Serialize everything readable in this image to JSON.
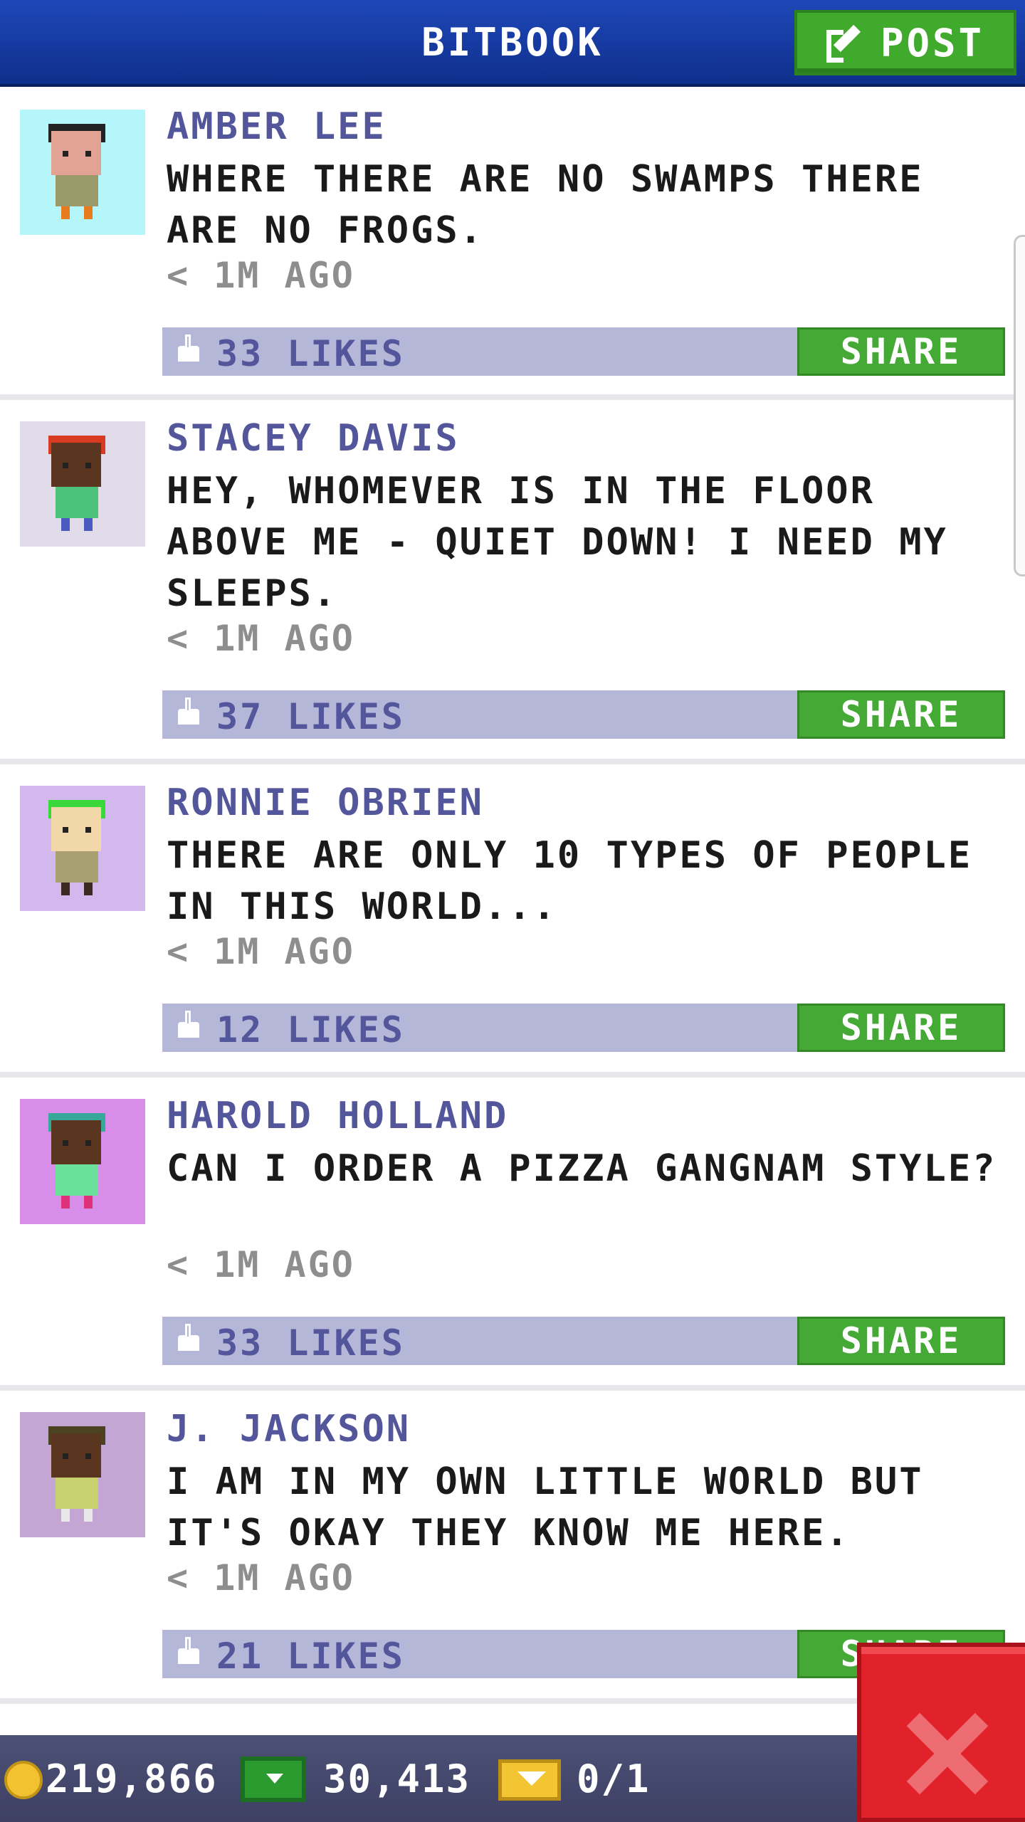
{
  "header": {
    "title": "BITBOOK",
    "post_label": "POST"
  },
  "posts": [
    {
      "name": "AMBER LEE",
      "message": "WHERE THERE ARE NO SWAMPS THERE ARE NO FROGS.",
      "time": "< 1M AGO",
      "likes": "33 LIKES",
      "share": "SHARE",
      "avatar_bg": "#b4f6fa"
    },
    {
      "name": "STACEY DAVIS",
      "message": "HEY, WHOMEVER IS IN THE FLOOR ABOVE ME - QUIET DOWN! I NEED MY SLEEPS.",
      "time": "< 1M AGO",
      "likes": "37 LIKES",
      "share": "SHARE",
      "avatar_bg": "#e2dcea"
    },
    {
      "name": "RONNIE OBRIEN",
      "message": "THERE ARE ONLY 10 TYPES OF PEOPLE IN THIS WORLD...",
      "time": "< 1M AGO",
      "likes": "12 LIKES",
      "share": "SHARE",
      "avatar_bg": "#d3b8ee"
    },
    {
      "name": "HAROLD HOLLAND",
      "message": "CAN I ORDER A PIZZA GANGNAM STYLE?",
      "time": "< 1M AGO",
      "likes": "33 LIKES",
      "share": "SHARE",
      "avatar_bg": "#d88ee8"
    },
    {
      "name": "J. JACKSON",
      "message": "I AM IN MY OWN LITTLE WORLD BUT IT'S OKAY THEY KNOW ME HERE.",
      "time": "< 1M AGO",
      "likes": "21 LIKES",
      "share": "SHARE",
      "avatar_bg": "#c4a6d4"
    }
  ],
  "bottom_bar": {
    "coins": "219,866",
    "bux": "30,413",
    "tickets": "0/1"
  },
  "colors": {
    "header": "#1e47b8",
    "accent_green": "#45a935",
    "like_bar": "#b4b7d8",
    "name_text": "#53569a",
    "close_red": "#e2222b"
  }
}
